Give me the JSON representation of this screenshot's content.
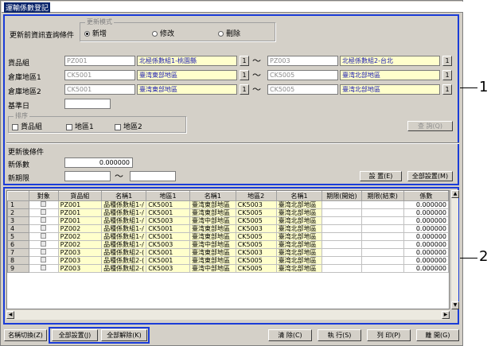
{
  "window": {
    "title": "運輸係數登記"
  },
  "criteria": {
    "label": "更新前資訊查詢條件",
    "mode_group": "更新模式",
    "modes": [
      "新增",
      "修改",
      "刪除"
    ],
    "selected_mode": "新增",
    "rows": [
      {
        "label": "貨品組",
        "from_code": "PZ001",
        "from_name": "北極係數組1-桃園縣",
        "to_code": "PZ003",
        "to_name": "北極係數組2-台北"
      },
      {
        "label": "倉庫地區1",
        "from_code": "CK5001",
        "from_name": "臺湾東部地區",
        "to_code": "CK5005",
        "to_name": "臺湾北部地區"
      },
      {
        "label": "倉庫地區2",
        "from_code": "CK5001",
        "from_name": "臺湾東部地區",
        "to_code": "CK5005",
        "to_name": "臺湾北部地區"
      }
    ],
    "lookup_button": "1",
    "tilde": "～",
    "base_date_label": "基準日",
    "base_date": "",
    "sort_group": "排序",
    "sort_options": [
      "貨品組",
      "地區1",
      "地區2"
    ],
    "query_button": "查 詢(Q)"
  },
  "update": {
    "label": "更新後條件",
    "new_coef_label": "新係數",
    "new_coef": "0.000000",
    "new_period_label": "新期限",
    "period_from": "",
    "period_to": "",
    "set_button": "設 置(E)",
    "set_all_button": "全部設置(M)"
  },
  "grid": {
    "columns": [
      "",
      "對象",
      "貨品組",
      "名稱1",
      "地區1",
      "名稱1",
      "地區2",
      "名稱1",
      "期限(開始)",
      "期限(結束)",
      "係數"
    ],
    "rows": [
      [
        "1",
        "",
        "PZ001",
        "品種係數組1-/",
        "CK5001",
        "臺湾東部地區",
        "CK5003",
        "臺湾北部地區",
        "",
        "",
        "0.000000"
      ],
      [
        "2",
        "",
        "PZ001",
        "品種係數組1-/",
        "CK5001",
        "臺湾東部地區",
        "CK5005",
        "臺湾北部地區",
        "",
        "",
        "0.000000"
      ],
      [
        "3",
        "",
        "PZ001",
        "品種係數組1-/",
        "CK5003",
        "臺湾中部地區",
        "CK5005",
        "臺湾北部地區",
        "",
        "",
        "0.000000"
      ],
      [
        "4",
        "",
        "PZ002",
        "品種係數組1-/",
        "CK5001",
        "臺湾東部地區",
        "CK5003",
        "臺湾北部地區",
        "",
        "",
        "0.000000"
      ],
      [
        "5",
        "",
        "PZ002",
        "品種係數組1-/",
        "CK5001",
        "臺湾東部地區",
        "CK5005",
        "臺湾北部地區",
        "",
        "",
        "0.000000"
      ],
      [
        "6",
        "",
        "PZ002",
        "品種係數組1-/",
        "CK5003",
        "臺湾中部地區",
        "CK5005",
        "臺湾北部地區",
        "",
        "",
        "0.000000"
      ],
      [
        "7",
        "",
        "PZ003",
        "品種係數組2-(",
        "CK5001",
        "臺湾東部地區",
        "CK5003",
        "臺湾北部地區",
        "",
        "",
        "0.000000"
      ],
      [
        "8",
        "",
        "PZ003",
        "品種係數組2-(",
        "CK5001",
        "臺湾東部地區",
        "CK5005",
        "臺湾北部地區",
        "",
        "",
        "0.000000"
      ],
      [
        "9",
        "",
        "PZ003",
        "品種係數組2-(",
        "CK5003",
        "臺湾中部地區",
        "CK5005",
        "臺湾北部地區",
        "",
        "",
        "0.000000"
      ]
    ]
  },
  "footer": {
    "name_switch": "名稱切換(Z)",
    "select_all": "全部設置(J)",
    "deselect_all": "全部解除(K)",
    "clear": "清 除(C)",
    "execute": "執 行(S)",
    "print": "列 印(P)",
    "close": "離 開(G)"
  },
  "callouts": [
    "1",
    "2"
  ]
}
